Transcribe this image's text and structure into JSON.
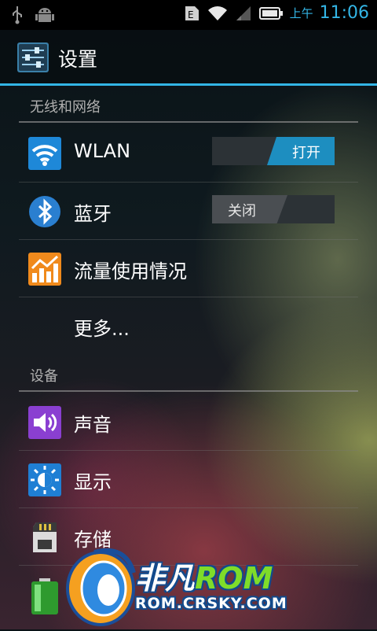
{
  "status_bar": {
    "ampm": "上午",
    "time": "11:06",
    "icons": [
      "usb-icon",
      "android-debug-icon",
      "sim-e-icon",
      "wifi-icon",
      "signal-icon",
      "battery-icon"
    ]
  },
  "action_bar": {
    "title": "设置",
    "icon": "settings-sliders-icon"
  },
  "sections": {
    "wireless": {
      "header": "无线和网络",
      "wlan": {
        "label": "WLAN",
        "toggle": "打开",
        "state": "on"
      },
      "bluetooth": {
        "label": "蓝牙",
        "toggle": "关闭",
        "state": "off"
      },
      "data_usage": {
        "label": "流量使用情况"
      },
      "more": {
        "label": "更多..."
      }
    },
    "device": {
      "header": "设备",
      "sound": {
        "label": "声音"
      },
      "display": {
        "label": "显示"
      },
      "storage": {
        "label": "存储"
      },
      "battery": {
        "label": "电池"
      }
    }
  },
  "watermark": {
    "name_part1": "非凡",
    "name_part2": "ROM",
    "url": "ROM.CRSKY.COM"
  },
  "colors": {
    "accent": "#33b5e5",
    "toggle_on": "#1d8ec0"
  }
}
